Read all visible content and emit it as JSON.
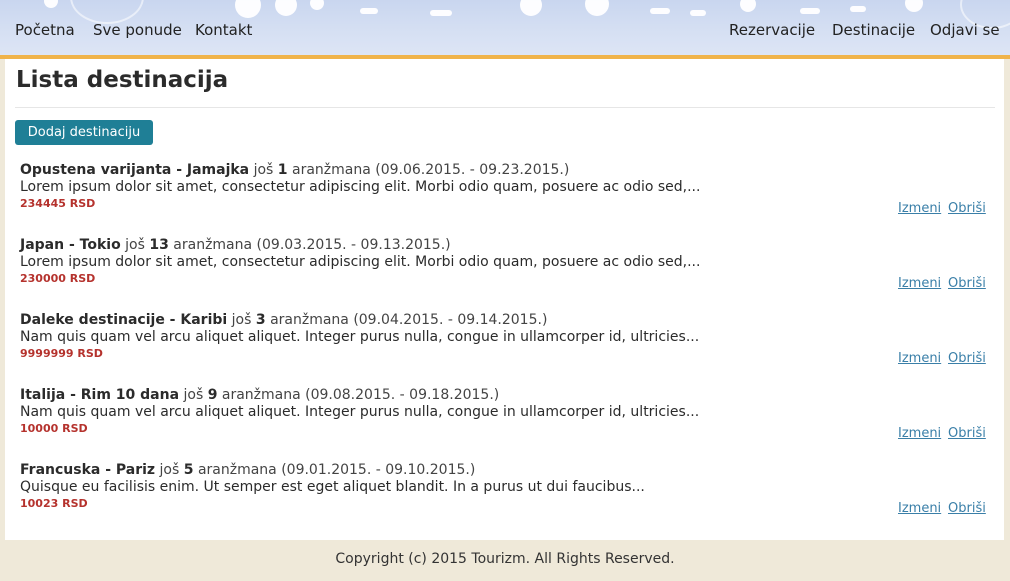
{
  "nav": {
    "left": [
      "Početna",
      "Sve ponude",
      "Kontakt"
    ],
    "right": [
      "Rezervacije",
      "Destinacije",
      "Odjavi se"
    ]
  },
  "page": {
    "title": "Lista destinacija",
    "add_button": "Dodaj destinaciju"
  },
  "destinations": [
    {
      "name": "Opustena varijanta - Jamajka",
      "pre": "još",
      "count": "1",
      "post": "aranžmana (09.06.2015. - 09.23.2015.)",
      "desc": "Lorem ipsum dolor sit amet, consectetur adipiscing elit. Morbi odio quam, posuere ac odio sed,...",
      "price": "234445 RSD",
      "edit": "Izmeni",
      "delete": "Obriši"
    },
    {
      "name": "Japan - Tokio",
      "pre": "još",
      "count": "13",
      "post": "aranžmana (09.03.2015. - 09.13.2015.)",
      "desc": "Lorem ipsum dolor sit amet, consectetur adipiscing elit. Morbi odio quam, posuere ac odio sed,...",
      "price": "230000 RSD",
      "edit": "Izmeni",
      "delete": "Obriši"
    },
    {
      "name": "Daleke destinacije - Karibi",
      "pre": "još",
      "count": "3",
      "post": "aranžmana (09.04.2015. - 09.14.2015.)",
      "desc": "Nam quis quam vel arcu aliquet aliquet. Integer purus nulla, congue in ullamcorper id, ultricies...",
      "price": "9999999 RSD",
      "edit": "Izmeni",
      "delete": "Obriši"
    },
    {
      "name": "Italija - Rim 10 dana",
      "pre": "još",
      "count": "9",
      "post": "aranžmana (09.08.2015. - 09.18.2015.)",
      "desc": "Nam quis quam vel arcu aliquet aliquet. Integer purus nulla, congue in ullamcorper id, ultricies...",
      "price": "10000 RSD",
      "edit": "Izmeni",
      "delete": "Obriši"
    },
    {
      "name": "Francuska - Pariz",
      "pre": "još",
      "count": "5",
      "post": "aranžmana (09.01.2015. - 09.10.2015.)",
      "desc": "Quisque eu facilisis enim. Ut semper est eget aliquet blandit. In a purus ut dui faucibus...",
      "price": "10023 RSD",
      "edit": "Izmeni",
      "delete": "Obriši"
    }
  ],
  "footer": "Copyright (c) 2015 Tourizm. All Rights Reserved."
}
